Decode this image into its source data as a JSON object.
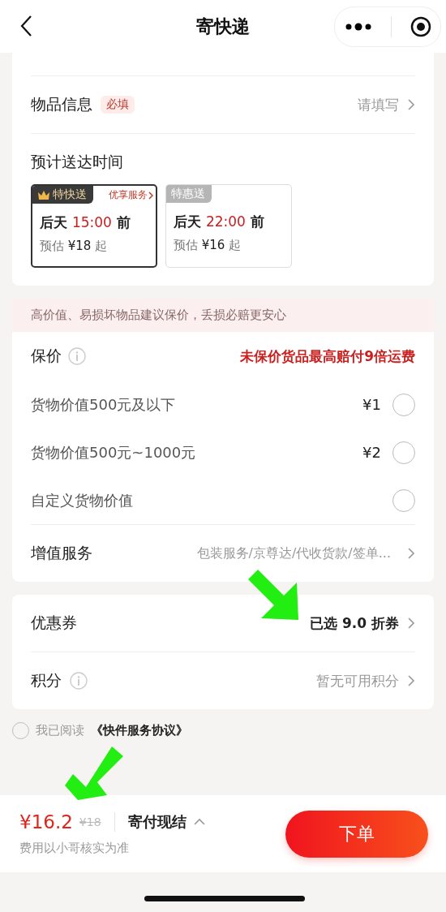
{
  "nav": {
    "title": "寄快递"
  },
  "item_info": {
    "label": "物品信息",
    "badge": "必填",
    "value": "请填写"
  },
  "delivery": {
    "title": "预计送达时间",
    "options": [
      {
        "tag": "特快送",
        "kind": "premium",
        "link": "优享服务",
        "day": "后天",
        "time": "15:00",
        "suffix": "前",
        "estimate": "预估",
        "price": "¥18",
        "price_suffix": "起",
        "selected": true
      },
      {
        "tag": "特惠送",
        "kind": "standard",
        "day": "后天",
        "time": "22:00",
        "suffix": "前",
        "estimate": "预估",
        "price": "¥16",
        "price_suffix": "起",
        "selected": false
      }
    ]
  },
  "notice": "高价值、易损坏物品建议保价，丢损必赔更安心",
  "insurance": {
    "label": "保价",
    "note": "未保价货品最高赔付9倍运费",
    "options": [
      {
        "label": "货物价值500元及以下",
        "price": "¥1",
        "selected": false
      },
      {
        "label": "货物价值500元~1000元",
        "price": "¥2",
        "selected": false
      },
      {
        "label": "自定义货物价值",
        "selected": false
      }
    ]
  },
  "value_added": {
    "label": "增值服务",
    "value": "包装服务/京尊达/代收货款/签单..."
  },
  "coupon": {
    "label": "优惠券",
    "value": "已选 9.0 折券"
  },
  "points": {
    "label": "积分",
    "value": "暂无可用积分"
  },
  "agreement": {
    "text": "我已阅读",
    "link": "《快件服务协议》",
    "checked": false
  },
  "footer": {
    "price": "¥16.2",
    "original_price": "¥18",
    "payment": "寄付现结",
    "note": "费用以小哥核实为准",
    "submit": "下单"
  }
}
